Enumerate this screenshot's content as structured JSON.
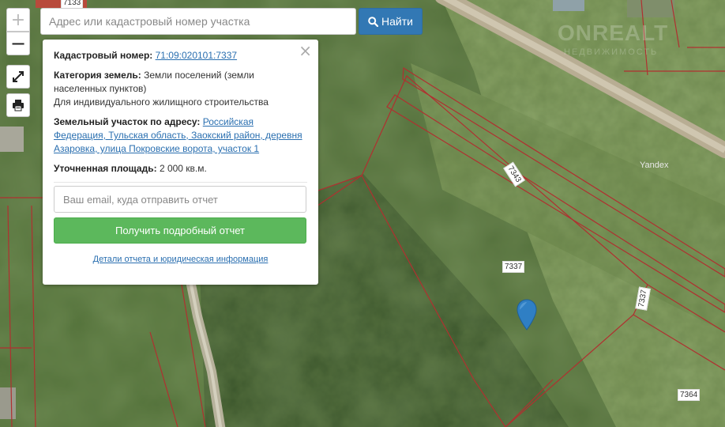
{
  "search": {
    "placeholder": "Адрес или кадастровый номер участка",
    "button_label": "Найти",
    "button_icon": "search-icon"
  },
  "map_controls": {
    "zoom_in": "+",
    "zoom_out": "−",
    "fullscreen_icon": "expand-icon",
    "print_icon": "print-icon"
  },
  "popup": {
    "close": "×",
    "cadastral_label": "Кадастровый номер:",
    "cadastral_number": "71:09:020101:7337",
    "category_label": "Категория земель:",
    "category_value": "Земли поселений (земли населенных пунктов)",
    "usage": "Для индивидуального жилищного строительства",
    "address_label": "Земельный участок по адресу:",
    "address_value": "Российская Федерация, Тульская область, Заокский район, деревня Азаровка, улица Покровские ворота, участок 1",
    "area_label": "Уточненная площадь:",
    "area_value": "2 000 кв.м.",
    "email_placeholder": "Ваш email, куда отправить отчет",
    "report_button": "Получить подробный отчет",
    "details_link": "Детали отчета и юридическая информация"
  },
  "map": {
    "parcel_labels": {
      "main": "7337",
      "p7343": "7343",
      "side": "7337",
      "p7364": "7364",
      "top": "7133"
    },
    "provider": "Yandex",
    "watermark_main": "ONREALT",
    "watermark_sub": "НЕДВИЖИМОСТЬ",
    "colors": {
      "parcel_border": "#b03030",
      "marker": "#2f7fc4",
      "report_button": "#5cb85c",
      "search_button": "#3278b4"
    }
  }
}
